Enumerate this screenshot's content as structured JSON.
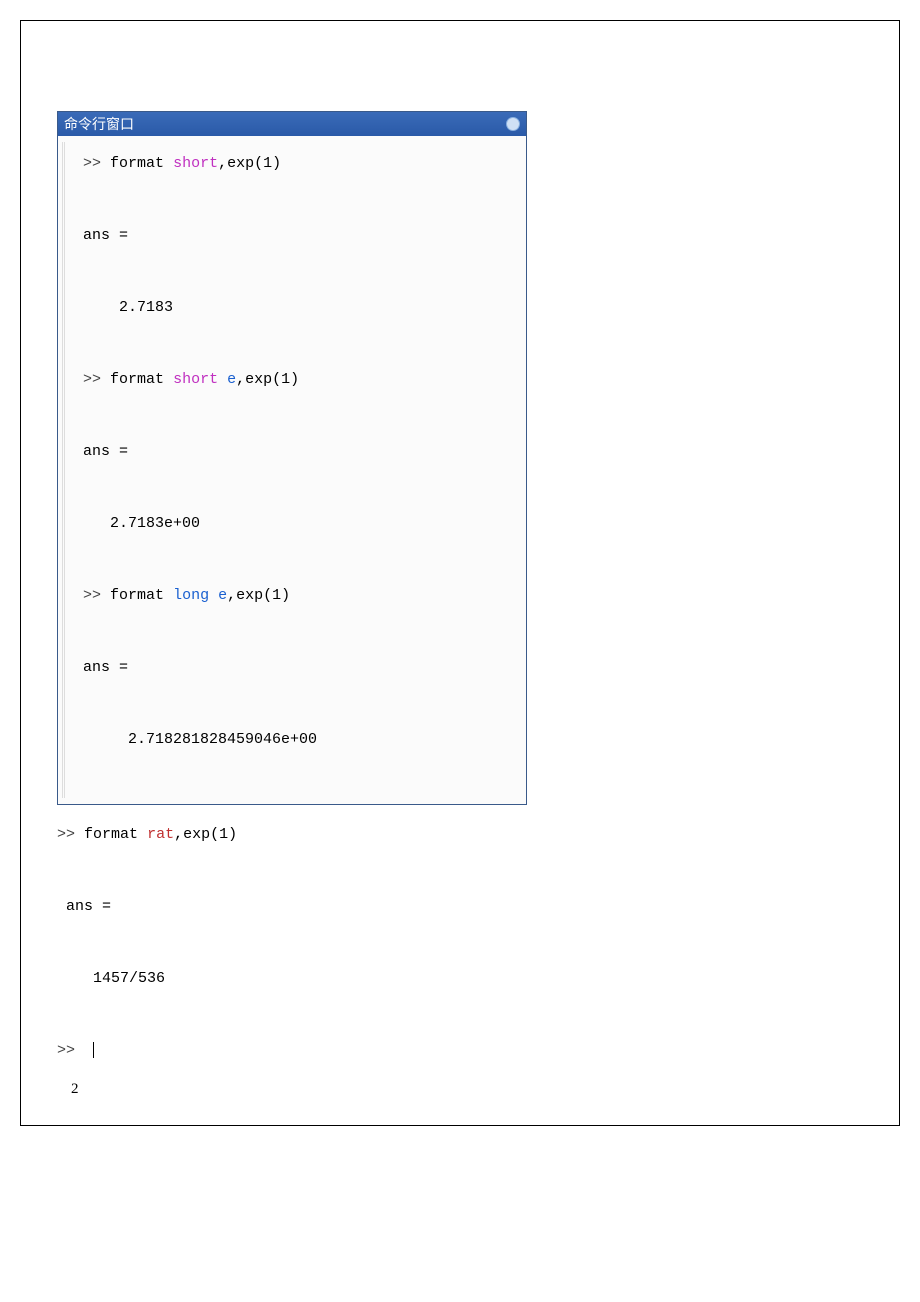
{
  "titlebar": {
    "title": "命令行窗口"
  },
  "prompt": ">>",
  "kw": {
    "format": "format",
    "short": "short",
    "short_e": "short",
    "e": "e",
    "long": "long",
    "rat": "rat",
    "exp": "exp(1)"
  },
  "ans_label": "ans =",
  "results": {
    "short": "2.7183",
    "short_e": "2.7183e+00",
    "long_e": "2.718281828459046e+00",
    "rat": "1457/536"
  },
  "footnote": "2"
}
